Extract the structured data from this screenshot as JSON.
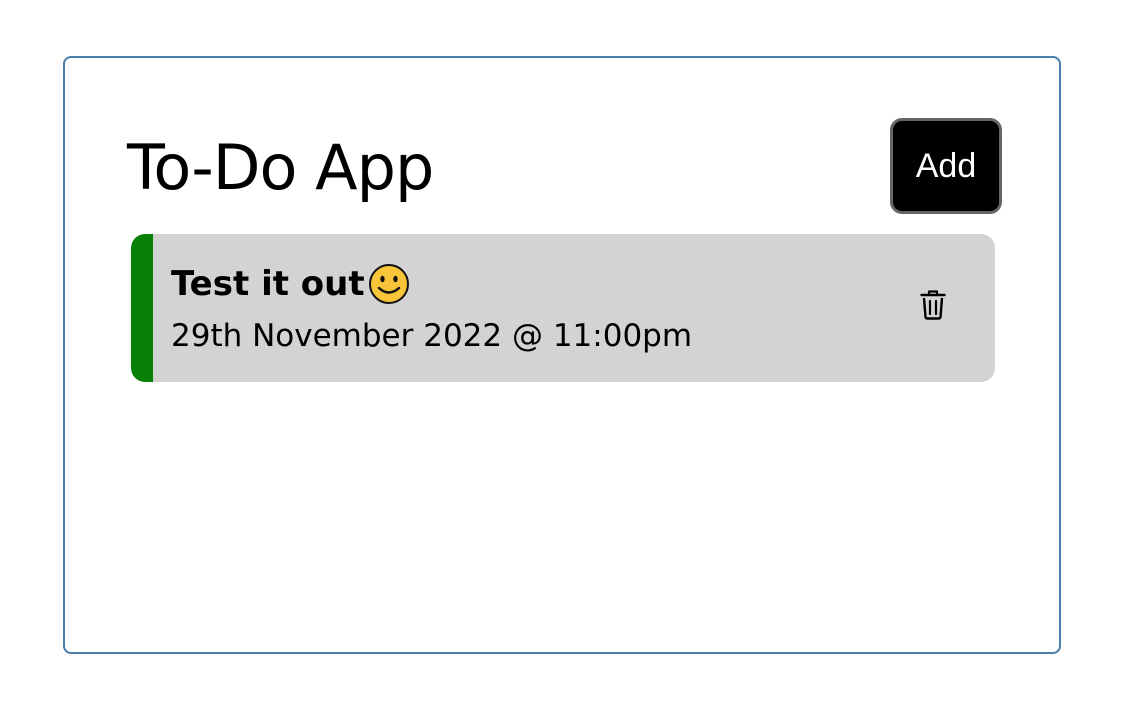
{
  "app": {
    "title": "To-Do App",
    "add_label": "Add"
  },
  "todos": [
    {
      "title": "Test it out",
      "emoji_icon": "smiley-face-icon",
      "date": "29th November 2022 @ 11:00pm",
      "status_color": "#068006",
      "delete_icon": "trash-icon"
    }
  ],
  "colors": {
    "card_border": "#4a7ea8",
    "item_background": "#d3d3d3",
    "button_background": "#000000",
    "button_text": "#ffffff"
  }
}
